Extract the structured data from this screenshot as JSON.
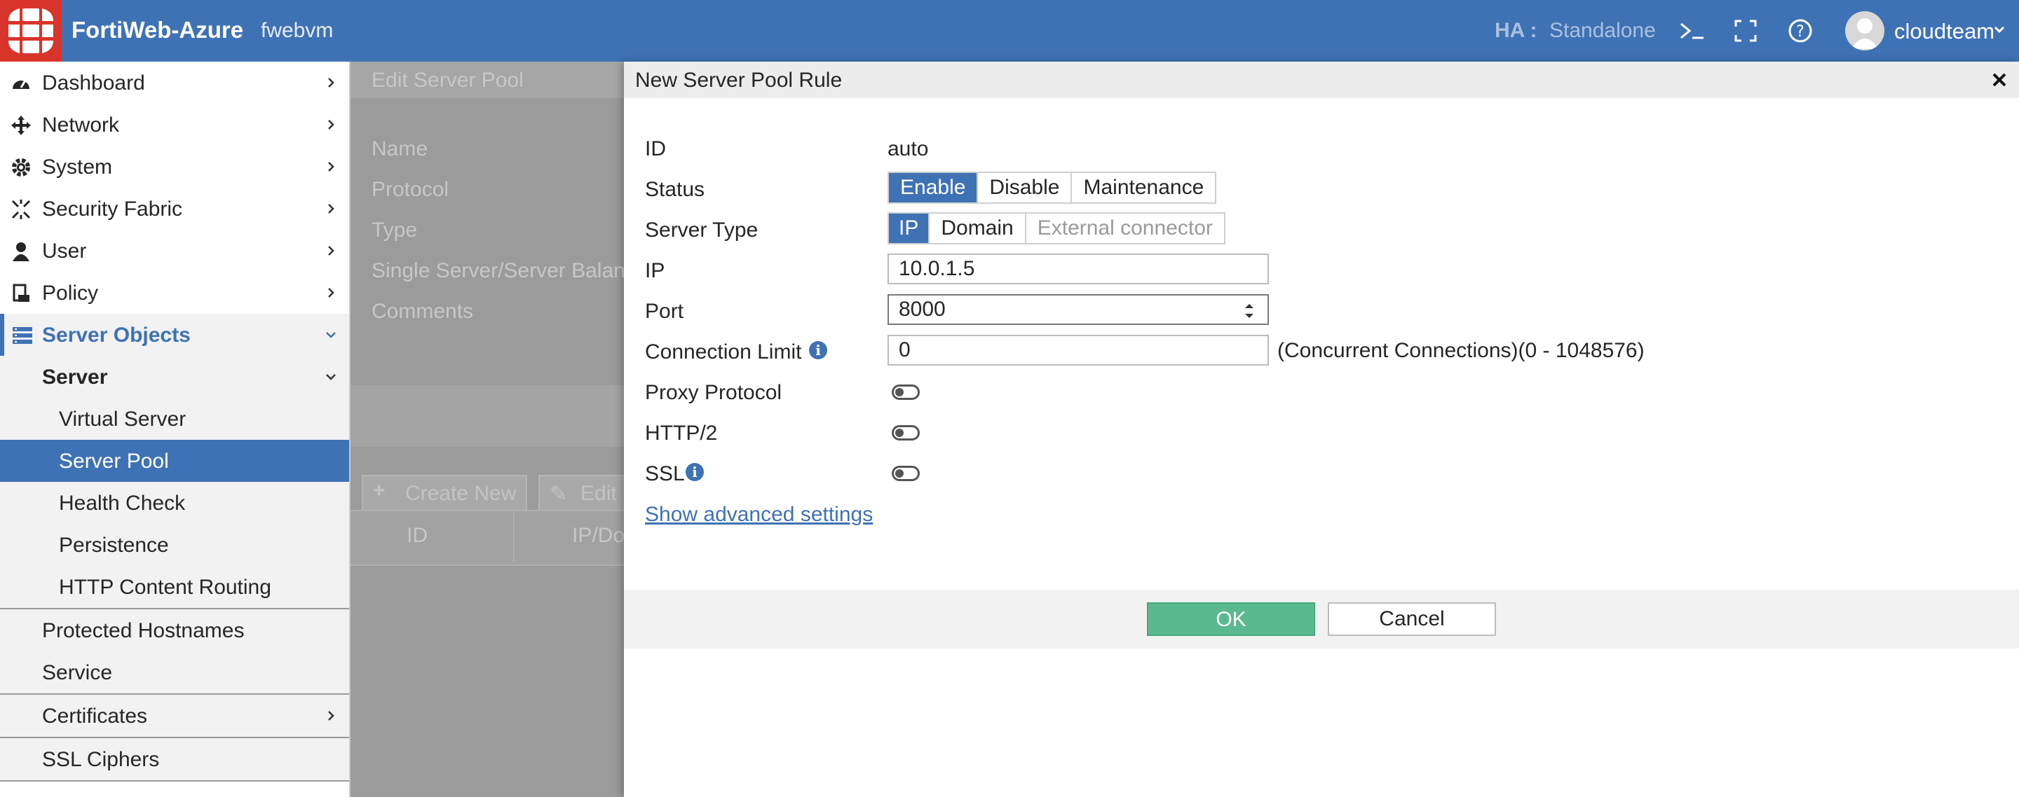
{
  "topbar": {
    "app_title": "FortiWeb-Azure",
    "hostname": "fwebvm",
    "ha_label": "HA :",
    "ha_value": "Standalone",
    "user": "cloudteam",
    "icons": [
      "cli-icon",
      "fullscreen-icon",
      "help-icon",
      "avatar-icon"
    ],
    "accent_color": "#3f72b4",
    "logo_color": "#d9342b"
  },
  "sidebar": {
    "items": [
      {
        "label": "Dashboard",
        "icon": "dashboard-icon"
      },
      {
        "label": "Network",
        "icon": "network-icon"
      },
      {
        "label": "System",
        "icon": "gear-icon"
      },
      {
        "label": "Security Fabric",
        "icon": "security-fabric-icon"
      },
      {
        "label": "User",
        "icon": "user-icon"
      },
      {
        "label": "Policy",
        "icon": "policy-icon"
      },
      {
        "label": "Server Objects",
        "icon": "server-icon",
        "expanded": true
      },
      {
        "label": "Server",
        "expanded": true
      },
      {
        "label": "Virtual Server"
      },
      {
        "label": "Server Pool",
        "selected": true
      },
      {
        "label": "Health Check"
      },
      {
        "label": "Persistence"
      },
      {
        "label": "HTTP Content Routing"
      },
      {
        "label": "Protected Hostnames"
      },
      {
        "label": "Service"
      },
      {
        "label": "Certificates"
      },
      {
        "label": "SSL Ciphers"
      }
    ]
  },
  "background_page": {
    "title": "Edit Server Pool",
    "fields": [
      "Name",
      "Protocol",
      "Type",
      "Single Server/Server Balance",
      "Comments"
    ],
    "create_new": "Create New",
    "edit": "Edit",
    "columns": [
      "ID",
      "IP/Domain"
    ]
  },
  "dialog": {
    "title": "New Server Pool Rule",
    "id_label": "ID",
    "id_value": "auto",
    "status_label": "Status",
    "status_options": [
      "Enable",
      "Disable",
      "Maintenance"
    ],
    "status_selected": "Enable",
    "server_type_label": "Server Type",
    "server_type_options": [
      "IP",
      "Domain",
      "External connector"
    ],
    "server_type_selected": "IP",
    "ip_label": "IP",
    "ip_value": "10.0.1.5",
    "port_label": "Port",
    "port_value": "8000",
    "conn_limit_label": "Connection Limit",
    "conn_limit_value": "0",
    "conn_limit_hint": "(Concurrent Connections)(0 - 1048576)",
    "proxy_protocol_label": "Proxy Protocol",
    "proxy_protocol_on": false,
    "http2_label": "HTTP/2",
    "http2_on": false,
    "ssl_label": "SSL",
    "ssl_on": false,
    "advanced_link": "Show advanced settings",
    "ok_label": "OK",
    "cancel_label": "Cancel",
    "ok_color": "#5bb98f"
  }
}
